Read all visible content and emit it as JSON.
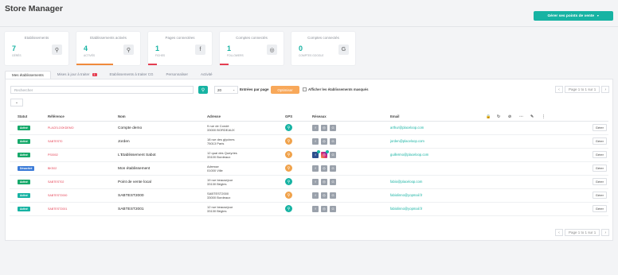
{
  "header": {
    "title": "Store Manager",
    "cta_label": "Gérer ses points de vente",
    "cta_caret": "▼"
  },
  "cards": [
    {
      "title": "Etablissements",
      "value": "7",
      "sub": "GÉRÉS",
      "icon": "⚲",
      "icon_name": "location-icon",
      "accent": "#17b3a3",
      "bar": null
    },
    {
      "title": "Etablissements activés",
      "value": "4",
      "sub": "ACTIVÉS",
      "icon": "⚲",
      "icon_name": "location-icon",
      "accent": "#17b3a3",
      "bar": {
        "pct": 57,
        "color": "#f08a3c"
      }
    },
    {
      "title": "Pages connectées",
      "value": "1",
      "sub": "FICHES",
      "icon": "f",
      "icon_name": "facebook-icon",
      "accent": "#17b3a3",
      "bar": {
        "pct": 14,
        "color": "#e53e51"
      }
    },
    {
      "title": "Comptes connectés",
      "value": "1",
      "sub": "FOLLOWERS",
      "icon": "◎",
      "icon_name": "instagram-icon",
      "accent": "#17b3a3",
      "bar": {
        "pct": 14,
        "color": "#e53e51"
      }
    },
    {
      "title": "Comptes connectés",
      "value": "0",
      "sub": "COMPTES GOOGLE",
      "icon": "G",
      "icon_name": "google-icon",
      "accent": "#17b3a3",
      "bar": null
    }
  ],
  "tabs": [
    {
      "label": "Mes établissements",
      "active": true,
      "badge": ""
    },
    {
      "label": "Mises à jour à traiter",
      "active": false,
      "badge": "1"
    },
    {
      "label": "Etablissements à traiter CG",
      "active": false,
      "badge": ""
    },
    {
      "label": "Personnaliser",
      "active": false,
      "badge": ""
    },
    {
      "label": "Activité",
      "active": false,
      "badge": ""
    }
  ],
  "toolbar": {
    "search_placeholder": "Rechercher",
    "per_page": "20",
    "per_page_label": "Entrées par page",
    "optimize_label": "Optimiser",
    "masked_label": "Afficher les établissements masqués",
    "page_info": "Page 1 to 1 sur 1"
  },
  "columns": {
    "statut": "Statut",
    "reference": "Référence",
    "nom": "Nom",
    "adresse": "Adresse",
    "gps": "GPS",
    "reseaux": "Réseaux",
    "email": "Email"
  },
  "rows": [
    {
      "status": "Activé",
      "status_color": "#17a96b",
      "ref": "PLACELOOKDEMO",
      "name": "Compte demo",
      "addr1": "9 rue de Condé",
      "addr2": "33000 BORDEAUX",
      "gps_color": "#17b3a3",
      "fb_connected": false,
      "ig_connected": false,
      "email": "arthur@placeloop.com"
    },
    {
      "status": "Activé",
      "status_color": "#17a96b",
      "ref": "SABTEST0",
      "name": "Jorden",
      "addr1": "18 rue des glycines",
      "addr2": "75013 Paris",
      "gps_color": "#f0a24b",
      "fb_connected": false,
      "ig_connected": false,
      "email": "jorden@placeloop.com"
    },
    {
      "status": "Activé",
      "status_color": "#17a96b",
      "ref": "PS0002",
      "name": "L'Etablissement Sabot",
      "addr1": "12 quai des Queyries",
      "addr2": "33100 Bordeaux",
      "gps_color": "#f0a24b",
      "fb_connected": true,
      "ig_connected": true,
      "email": "guillermo@placeloop.com"
    },
    {
      "status": "Désactivé",
      "status_color": "#3b7bd8",
      "ref": "BKS02",
      "name": "Mon établissement",
      "addr1": "Adresse",
      "addr2": "01000 Ville",
      "gps_color": "#f0a24b",
      "fb_connected": false,
      "ig_connected": false,
      "email": ""
    },
    {
      "status": "Activé",
      "status_color": "#17a96b",
      "ref": "SABTEST02",
      "name": "Point de vente local",
      "addr1": "19 rue beausejour",
      "addr2": "33130 Bègles",
      "gps_color": "#17b3a3",
      "fb_connected": false,
      "ig_connected": false,
      "email": "fabio@placeloop.com"
    },
    {
      "status": "Activé",
      "status_color": "#17b3a3",
      "ref": "SABTEST2000",
      "name": "SABTEST2000",
      "addr1": "SABTEST2000",
      "addr2": "33000 Bordeaux",
      "gps_color": "#f0a24b",
      "fb_connected": false,
      "ig_connected": false,
      "email": "fabiolinno@yopmail.fr"
    },
    {
      "status": "Activé",
      "status_color": "#17b3a3",
      "ref": "SABTEST2001",
      "name": "SABTEST2001",
      "addr1": "12 rue beausejour",
      "addr2": "33130 Bègles",
      "gps_color": "#17b3a3",
      "fb_connected": false,
      "ig_connected": false,
      "email": "fabiolinno@yopmail.fr"
    }
  ],
  "row_action_label": "Gérer"
}
